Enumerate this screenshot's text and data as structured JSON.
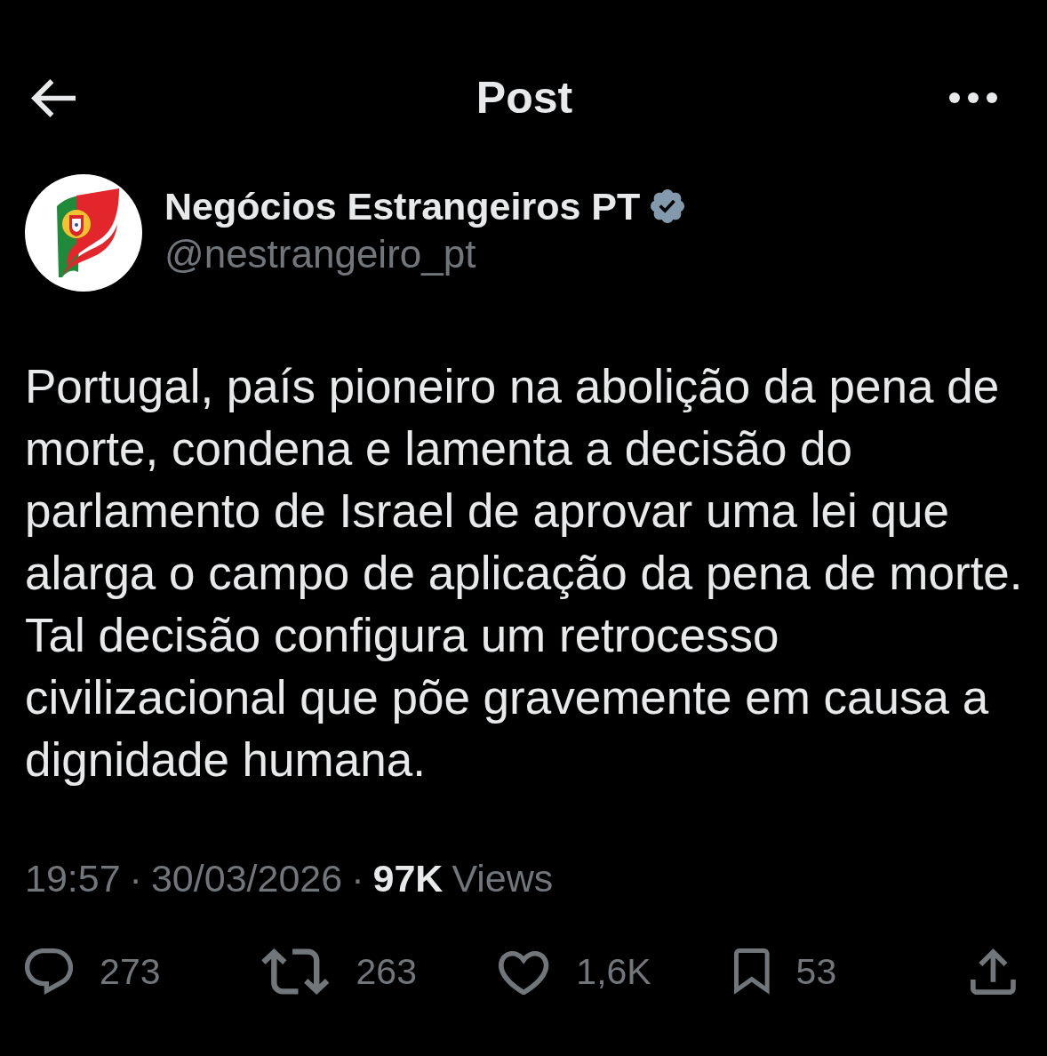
{
  "header": {
    "title": "Post"
  },
  "author": {
    "name": "Negócios Estrangeiros PT",
    "handle": "@nestrangeiro_pt",
    "verified": true
  },
  "text": "Portugal, país pioneiro na abolição da pena de morte, condena e lamenta a decisão do parlamento de Israel de aprovar uma lei que alarga o campo de aplicação da pena de morte. Tal decisão configura um retrocesso civilizacional que põe gravemente em causa a dignidade humana.",
  "meta": {
    "time": "19:57",
    "separators": [
      "·",
      "·"
    ],
    "date": "30/03/2026",
    "views_count": "97K",
    "views_label": "Views"
  },
  "actions": [
    {
      "kind": "reply",
      "count": "273"
    },
    {
      "kind": "repost",
      "count": "263"
    },
    {
      "kind": "like",
      "count": "1,6K"
    },
    {
      "kind": "bookmark",
      "count": "53"
    },
    {
      "kind": "share"
    }
  ]
}
